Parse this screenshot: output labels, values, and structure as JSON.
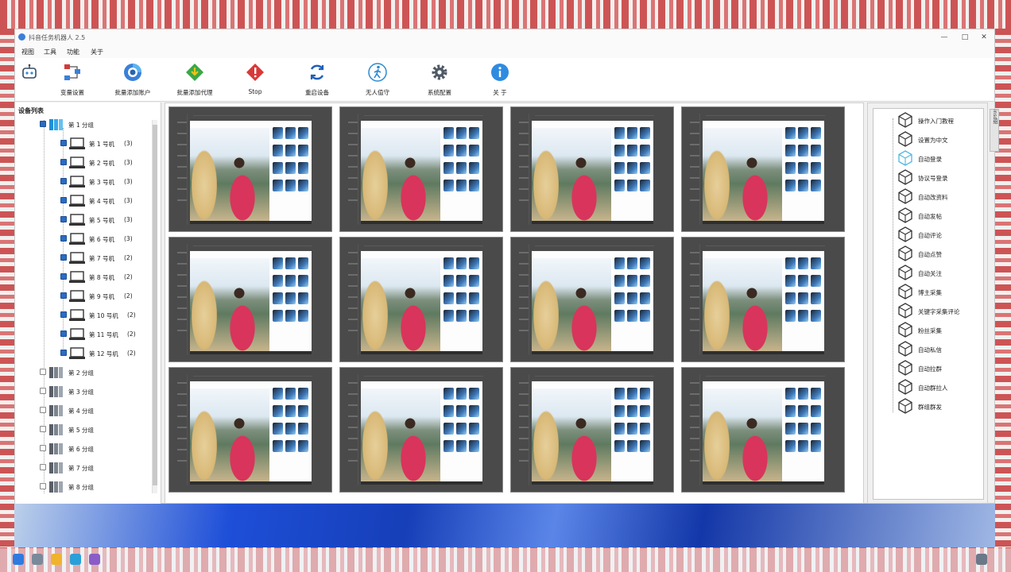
{
  "window": {
    "title": "抖音任务机器人 2.5"
  },
  "menu": [
    "视图",
    "工具",
    "功能",
    "关于"
  ],
  "toolbar": [
    {
      "label": "",
      "icon": "robot-icon"
    },
    {
      "label": "变量设置",
      "icon": "flow-icon",
      "color": "#d23b3b"
    },
    {
      "label": "批量添加账户",
      "icon": "chrome-icon",
      "color": "#3a80d9"
    },
    {
      "label": "批量添加代理",
      "icon": "download-diamond-icon",
      "color": "#3ba745"
    },
    {
      "label": "Stop",
      "icon": "warning-icon",
      "color": "#d73a3a"
    },
    {
      "label": "重启设备",
      "icon": "refresh-icon",
      "color": "#1f5fb8"
    },
    {
      "label": "无人值守",
      "icon": "walker-icon",
      "color": "#2a8bd0"
    },
    {
      "label": "系统配置",
      "icon": "gear-icon",
      "color": "#505a66"
    },
    {
      "label": "关 于",
      "icon": "info-icon",
      "color": "#2f8be0"
    }
  ],
  "device_list": {
    "title": "设备列表",
    "groups": [
      {
        "label": "第 1 分组",
        "checked": true,
        "expanded": true
      },
      {
        "label": "第 2 分组",
        "checked": false
      },
      {
        "label": "第 3 分组",
        "checked": false
      },
      {
        "label": "第 4 分组",
        "checked": false
      },
      {
        "label": "第 5 分组",
        "checked": false
      },
      {
        "label": "第 6 分组",
        "checked": false
      },
      {
        "label": "第 7 分组",
        "checked": false
      },
      {
        "label": "第 8 分组",
        "checked": false
      }
    ],
    "devices": [
      {
        "label": "第 1 号机",
        "count": "(3)"
      },
      {
        "label": "第 2 号机",
        "count": "(3)"
      },
      {
        "label": "第 3 号机",
        "count": "(3)"
      },
      {
        "label": "第 4 号机",
        "count": "(3)"
      },
      {
        "label": "第 5 号机",
        "count": "(3)"
      },
      {
        "label": "第 6 号机",
        "count": "(3)"
      },
      {
        "label": "第 7 号机",
        "count": "(2)"
      },
      {
        "label": "第 8 号机",
        "count": "(2)"
      },
      {
        "label": "第 9 号机",
        "count": "(2)"
      },
      {
        "label": "第 10 号机",
        "count": "(2)"
      },
      {
        "label": "第 11 号机",
        "count": "(2)"
      },
      {
        "label": "第 12 号机",
        "count": "(2)"
      }
    ]
  },
  "screens": {
    "rows": 3,
    "cols": 4
  },
  "functions": {
    "tab_label": "insd组",
    "items": [
      "操作入门教程",
      "设置为中文",
      "自动登录",
      "协议号登录",
      "自动改资料",
      "自动发帖",
      "自动评论",
      "自动点赞",
      "自动关注",
      "博主采集",
      "关键字采集评论",
      "粉丝采集",
      "自动私信",
      "自动拉群",
      "自动群拉人",
      "群组群发"
    ],
    "highlight_index": 2
  },
  "colors": {
    "accent": "#2a6cc2",
    "cube_highlight": "#4fb7e0"
  }
}
